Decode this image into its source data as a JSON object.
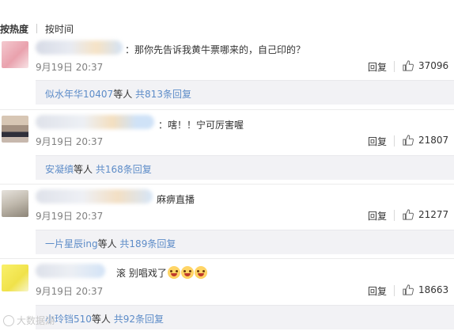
{
  "sort": {
    "hot": "按热度",
    "time": "按时间"
  },
  "labels": {
    "reply": "回复",
    "and_others": "等人",
    "total_prefix": "共",
    "total_suffix": "条回复"
  },
  "comments": [
    {
      "text": "：那你先告诉我黄牛票哪来的，自己印的？",
      "date": "9月19日 20:37",
      "likes": "37096",
      "sub_user": "似水年华10407",
      "sub_count": "813"
    },
    {
      "text": "：嗐！！宁可厉害喔",
      "date": "9月19日 20:37",
      "likes": "21807",
      "sub_user": "安凝缜",
      "sub_count": "168"
    },
    {
      "text": "麻痹直播",
      "date": "9月19日 20:37",
      "likes": "21277",
      "sub_user": "一片星辰ing",
      "sub_count": "189"
    },
    {
      "text": "滚 别唱戏了",
      "emoji_count": 3,
      "date": "9月19日 20:37",
      "likes": "18663",
      "sub_user": "小玲铛510",
      "sub_count": "92"
    }
  ],
  "watermark": "大数据湖",
  "icons": {
    "like": "thumbs-up-icon",
    "emoji": "crying-laughing-emoji-icon"
  }
}
